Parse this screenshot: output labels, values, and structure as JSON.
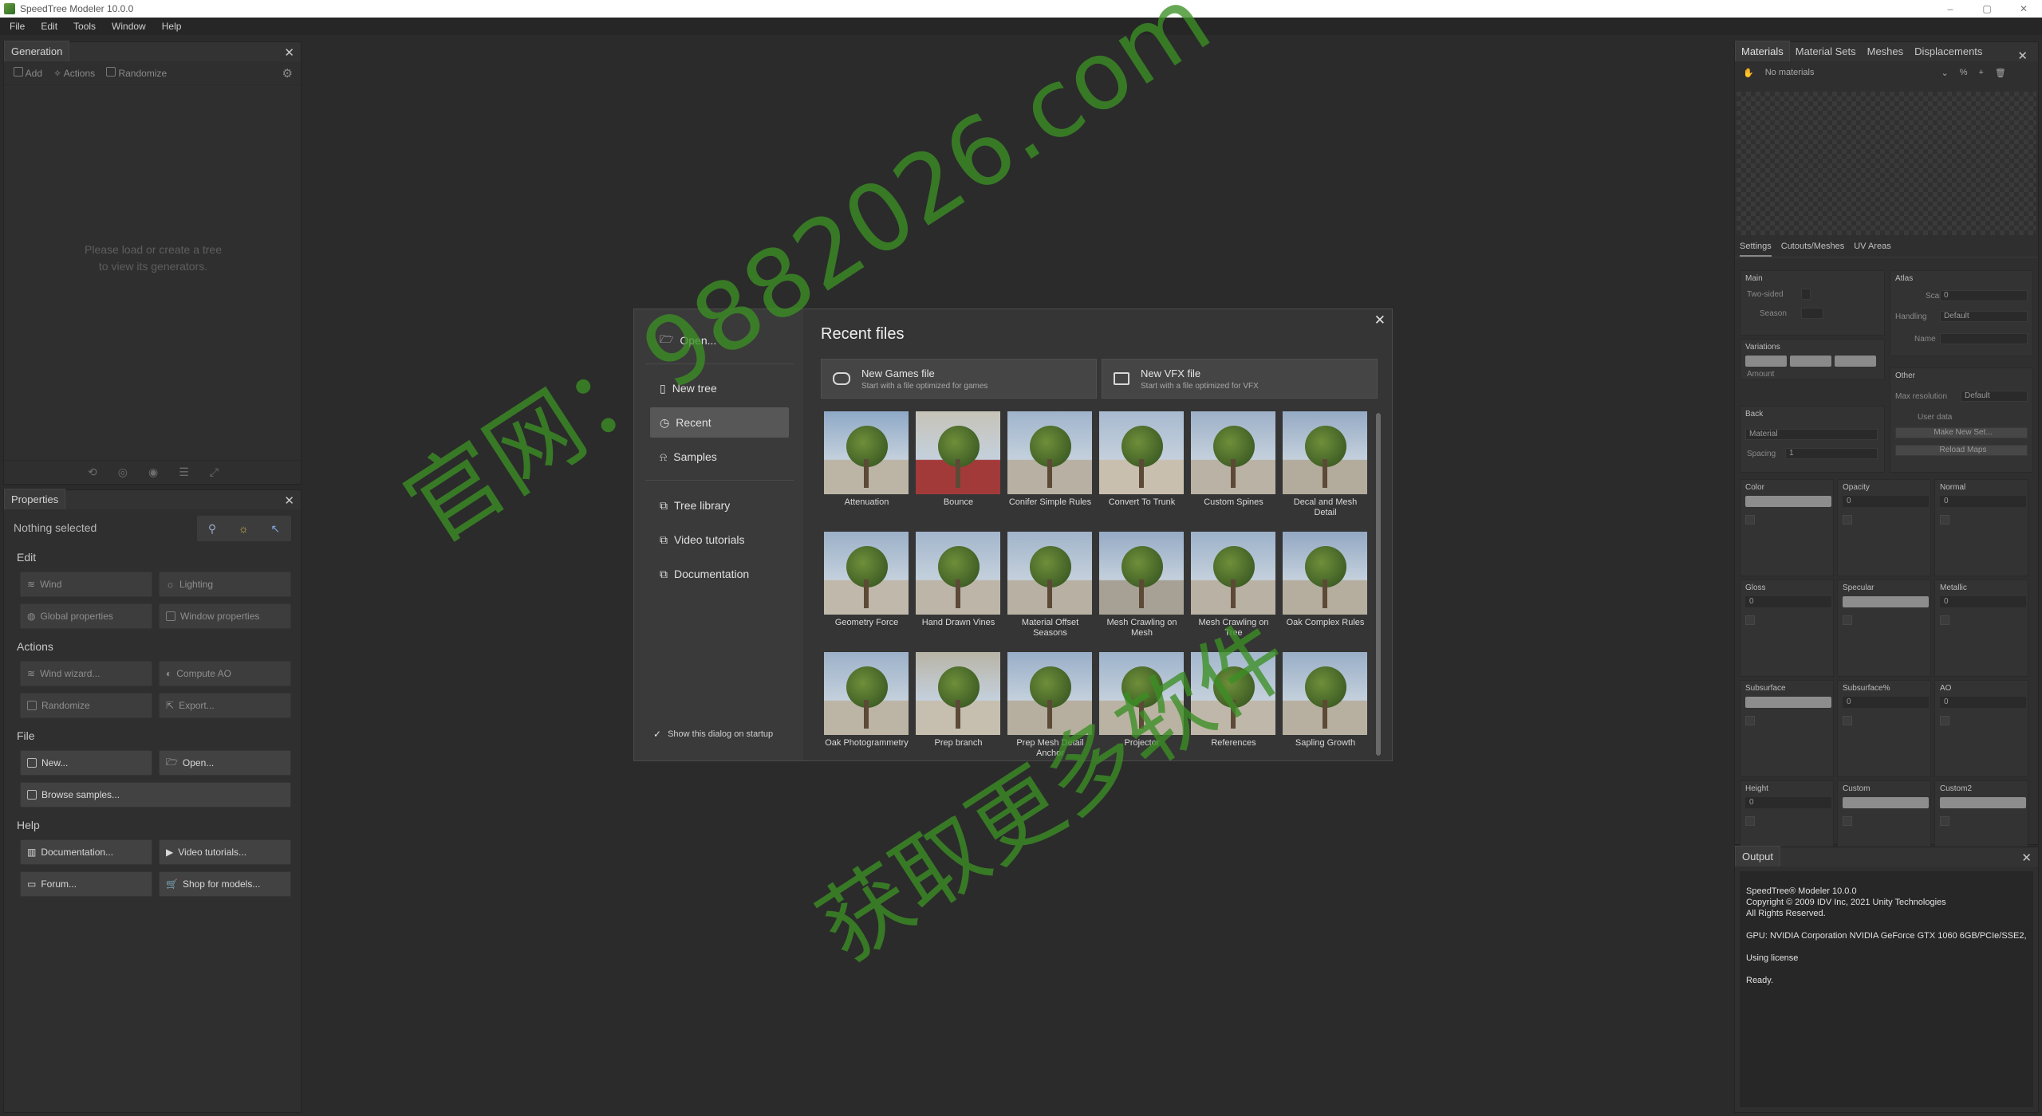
{
  "window": {
    "title": "SpeedTree  Modeler 10.0.0",
    "controls": [
      "–",
      "▢",
      "✕"
    ]
  },
  "menu": [
    "File",
    "Edit",
    "Tools",
    "Window",
    "Help"
  ],
  "generation": {
    "tab": "Generation",
    "toolbar": {
      "add": "Add",
      "actions": "Actions",
      "randomize": "Randomize"
    },
    "empty_line1": "Please load or create a tree",
    "empty_line2": "to view its generators."
  },
  "properties": {
    "tab": "Properties",
    "nothing_selected": "Nothing selected",
    "edit_title": "Edit",
    "edit": {
      "wind": "Wind",
      "lighting": "Lighting",
      "global": "Global properties",
      "window": "Window properties"
    },
    "actions_title": "Actions",
    "actions": {
      "wind_wizard": "Wind wizard...",
      "compute_ao": "Compute AO",
      "randomize": "Randomize",
      "export": "Export..."
    },
    "file_title": "File",
    "file": {
      "new": "New...",
      "open": "Open...",
      "browse": "Browse samples..."
    },
    "help_title": "Help",
    "help": {
      "docs": "Documentation...",
      "videos": "Video tutorials...",
      "forum": "Forum...",
      "shop": "Shop for models..."
    }
  },
  "dialog": {
    "nav": {
      "open": "Open...",
      "new_tree": "New tree",
      "recent": "Recent",
      "samples": "Samples",
      "library": "Tree library",
      "videos": "Video tutorials",
      "docs": "Documentation"
    },
    "show_on_startup": "Show this dialog on startup",
    "title": "Recent files",
    "new_games": {
      "title": "New Games file",
      "subtitle": "Start with a file optimized for games"
    },
    "new_vfx": {
      "title": "New VFX file",
      "subtitle": "Start with a file optimized for VFX"
    },
    "recent_files": [
      "Attenuation",
      "Bounce",
      "Conifer Simple Rules",
      "Convert To Trunk",
      "Custom Spines",
      "Decal and Mesh Detail",
      "Geometry Force",
      "Hand Drawn Vines",
      "Material Offset Seasons",
      "Mesh Crawling on Mesh",
      "Mesh Crawling on Tree",
      "Oak Complex Rules",
      "Oak Photogrammetry",
      "Prep branch",
      "Prep Mesh Detail Anchor",
      "Projector",
      "References",
      "Sapling Growth"
    ]
  },
  "materials": {
    "tabs": [
      "Materials",
      "Material Sets",
      "Meshes",
      "Displacements"
    ],
    "dropdown": "No materials",
    "subtabs": [
      "Settings",
      "Cutouts/Meshes",
      "UV Areas"
    ],
    "main": {
      "title": "Main",
      "two_sided": "Two-sided",
      "season": "Season"
    },
    "variations": {
      "title": "Variations",
      "amount": "Amount"
    },
    "back": {
      "title": "Back",
      "material": "Material",
      "spacing": "Spacing",
      "spacing_val": "1"
    },
    "atlas": {
      "title": "Atlas",
      "scale": "Scale",
      "scale_val": "0",
      "handling": "Handling",
      "handling_val": "Default",
      "name": "Name"
    },
    "other": {
      "title": "Other",
      "max_res": "Max resolution",
      "max_res_val": "Default",
      "user_data": "User data",
      "make_set": "Make New Set...",
      "reload": "Reload Maps"
    },
    "slots": [
      {
        "name": "Color",
        "value": ""
      },
      {
        "name": "Opacity",
        "value": "0"
      },
      {
        "name": "Normal",
        "value": "0"
      },
      {
        "name": "Gloss",
        "value": "0"
      },
      {
        "name": "Specular",
        "value": ""
      },
      {
        "name": "Metallic",
        "value": "0"
      },
      {
        "name": "Subsurface",
        "value": ""
      },
      {
        "name": "Subsurface%",
        "value": "0"
      },
      {
        "name": "AO",
        "value": "0"
      },
      {
        "name": "Height",
        "value": "0"
      },
      {
        "name": "Custom",
        "value": ""
      },
      {
        "name": "Custom2",
        "value": ""
      }
    ]
  },
  "output": {
    "tab": "Output",
    "text": "SpeedTree® Modeler 10.0.0\nCopyright © 2009 IDV Inc, 2021 Unity Technologies\nAll Rights Reserved.\n\nGPU: NVIDIA Corporation NVIDIA GeForce GTX 1060 6GB/PCIe/SSE2,\n\nUsing license\n\nReady."
  },
  "watermark": {
    "line1": "官网：9882026.com",
    "line2": "获取更多软件"
  }
}
